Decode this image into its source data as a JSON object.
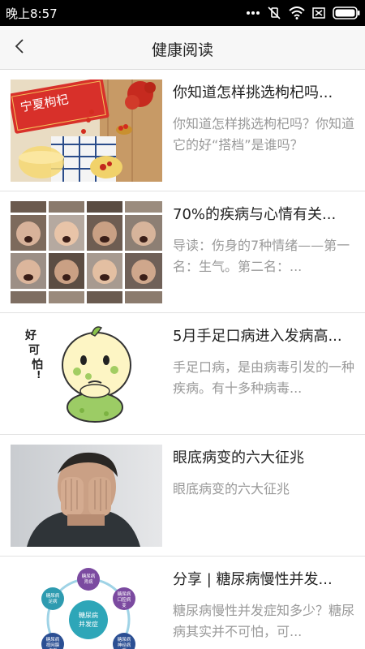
{
  "status_bar": {
    "time": "晚上8:57",
    "icons": [
      "dots-icon",
      "mute-icon",
      "wifi-icon",
      "sim-icon",
      "battery-icon"
    ]
  },
  "header": {
    "title": "健康阅读",
    "back_icon": "chevron-left-icon"
  },
  "articles": [
    {
      "title": "你知道怎样挑选枸杞吗...",
      "summary": "你知道怎样挑选枸杞吗？你知道它的好“搭档”是谁吗？",
      "thumb_logo_text": "宁夏枸杞"
    },
    {
      "title": "70%的疾病与心情有关...",
      "summary": "导读：伤身的7种情绪——第一名：生气。第二名：..."
    },
    {
      "title": "5月手足口病进入发病高...",
      "summary": "手足口病，是由病毒引发的一种疾病。有十多种病毒...",
      "thumb_caption": "好可怕！"
    },
    {
      "title": "眼底病变的六大征兆",
      "summary": "眼底病变的六大征兆"
    },
    {
      "title": "分享 | 糖尿病慢性并发...",
      "summary": "糖尿病慢性并发症知多少？糖尿病其实并不可怕，可...",
      "diagram": {
        "center": "糖尿病并发症",
        "nodes": [
          "糖尿病肾病",
          "糖尿病口腔病变",
          "糖尿病神经病变",
          "糖尿病视网膜病变",
          "糖尿病足病"
        ]
      }
    }
  ]
}
